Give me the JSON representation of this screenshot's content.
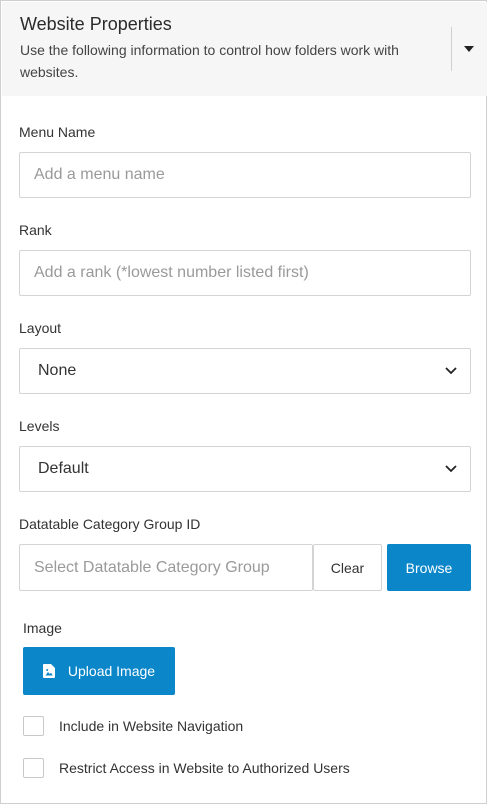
{
  "header": {
    "title": "Website Properties",
    "description": "Use the following information to control how folders work with websites."
  },
  "menu_name": {
    "label": "Menu Name",
    "placeholder": "Add a menu name",
    "value": ""
  },
  "rank": {
    "label": "Rank",
    "placeholder": "Add a rank (*lowest number listed first)",
    "value": ""
  },
  "layout": {
    "label": "Layout",
    "selected": "None"
  },
  "levels": {
    "label": "Levels",
    "selected": "Default"
  },
  "datatable": {
    "label": "Datatable Category Group ID",
    "placeholder": "Select Datatable Category Group",
    "value": "",
    "clear_label": "Clear",
    "browse_label": "Browse"
  },
  "image": {
    "label": "Image",
    "upload_label": "Upload Image"
  },
  "options": {
    "include_nav_label": "Include in Website Navigation",
    "include_nav_checked": false,
    "restrict_access_label": "Restrict Access in Website to Authorized Users",
    "restrict_access_checked": false
  },
  "colors": {
    "accent": "#0a86c9",
    "header_bg": "#f6f6f6",
    "border": "#d4d4d4"
  },
  "icons": {
    "collapse": "caret-down-icon",
    "select_chevron": "chevron-down-icon",
    "upload": "image-file-icon"
  }
}
